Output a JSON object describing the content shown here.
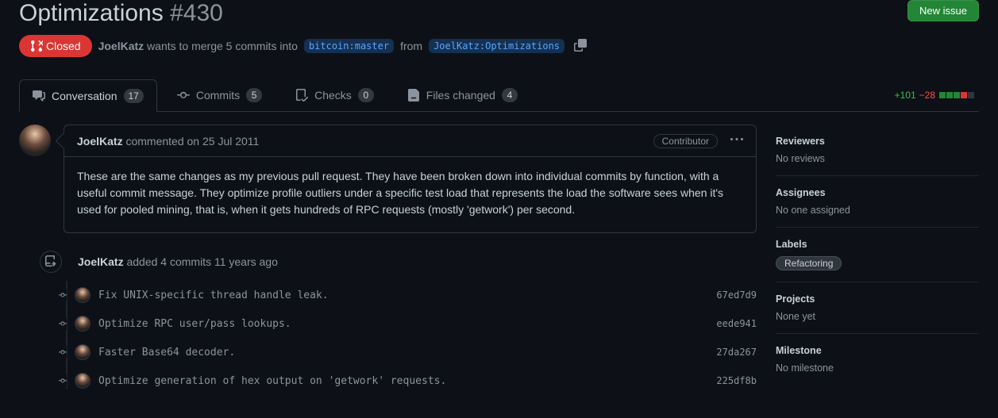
{
  "header": {
    "title": "Optimizations",
    "number": "#430",
    "new_issue_label": "New issue"
  },
  "status": {
    "state_label": "Closed",
    "author": "JoelKatz",
    "wants_text": "wants to merge 5 commits into",
    "base_branch": "bitcoin:master",
    "from_text": "from",
    "head_branch": "JoelKatz:Optimizations"
  },
  "tabs": {
    "conversation": {
      "label": "Conversation",
      "count": "17"
    },
    "commits": {
      "label": "Commits",
      "count": "5"
    },
    "checks": {
      "label": "Checks",
      "count": "0"
    },
    "files": {
      "label": "Files changed",
      "count": "4"
    }
  },
  "diffstat": {
    "add": "+101",
    "del": "−28"
  },
  "comment": {
    "author": "JoelKatz",
    "action": "commented",
    "date": "on 25 Jul 2011",
    "role": "Contributor",
    "body": "These are the same changes as my previous pull request. They have been broken down into individual commits by function, with a useful commit message. They optimize profile outliers under a specific test load that represents the load the software sees when it's used for pooled mining, that is, when it gets hundreds of RPC requests (mostly 'getwork') per second."
  },
  "event": {
    "author": "JoelKatz",
    "text": "added 4 commits",
    "time": "11 years ago"
  },
  "commits": [
    {
      "msg": "Fix UNIX-specific thread handle leak.",
      "sha": "67ed7d9"
    },
    {
      "msg": "Optimize RPC user/pass lookups.",
      "sha": "eede941"
    },
    {
      "msg": "Faster Base64 decoder.",
      "sha": "27da267"
    },
    {
      "msg": "Optimize generation of hex output on 'getwork' requests.",
      "sha": "225df8b"
    }
  ],
  "sidebar": {
    "reviewers": {
      "title": "Reviewers",
      "value": "No reviews"
    },
    "assignees": {
      "title": "Assignees",
      "value": "No one assigned"
    },
    "labels": {
      "title": "Labels",
      "value": "Refactoring"
    },
    "projects": {
      "title": "Projects",
      "value": "None yet"
    },
    "milestone": {
      "title": "Milestone",
      "value": "No milestone"
    }
  }
}
